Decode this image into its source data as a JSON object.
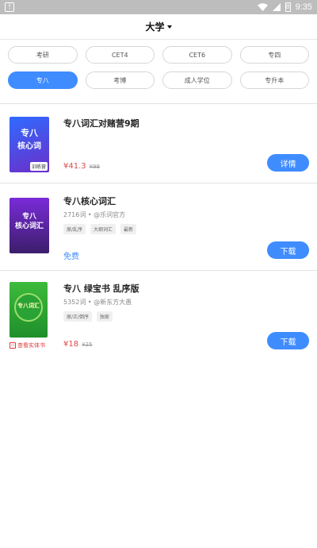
{
  "status_bar": {
    "left_icon": "!",
    "battery_text": "8",
    "time": "9:35"
  },
  "header": {
    "title": "大学"
  },
  "chips": {
    "row1": [
      "考研",
      "CET4",
      "CET6",
      "专四"
    ],
    "row2": [
      "专八",
      "考博",
      "成人学位",
      "专升本"
    ],
    "active": "专八"
  },
  "items": [
    {
      "title": "专八词汇对赌营9期",
      "price": "¥41.3",
      "old_price": "¥99",
      "button": "详情",
      "cover": {
        "line1": "专八",
        "line2": "核心词",
        "corner": "训练营"
      }
    },
    {
      "title": "专八核心词汇",
      "meta": "2716词 • @乐词官方",
      "tags": [
        "原/乱序",
        "大纲词汇",
        "最新"
      ],
      "free": "免费",
      "button": "下载",
      "cover": {
        "line1": "专八",
        "line2": "核心词汇"
      }
    },
    {
      "title": "专八 绿宝书 乱序版",
      "meta": "5352词 • @新东方大愚",
      "tags": [
        "原/正/倒序",
        "独家"
      ],
      "price": "¥18",
      "old_price": "¥25",
      "button": "下载",
      "badge": "查看实体书",
      "cover": {
        "line1": "专八词汇"
      }
    }
  ],
  "colors": {
    "accent": "#3f8cff",
    "price_red": "#e04848"
  }
}
